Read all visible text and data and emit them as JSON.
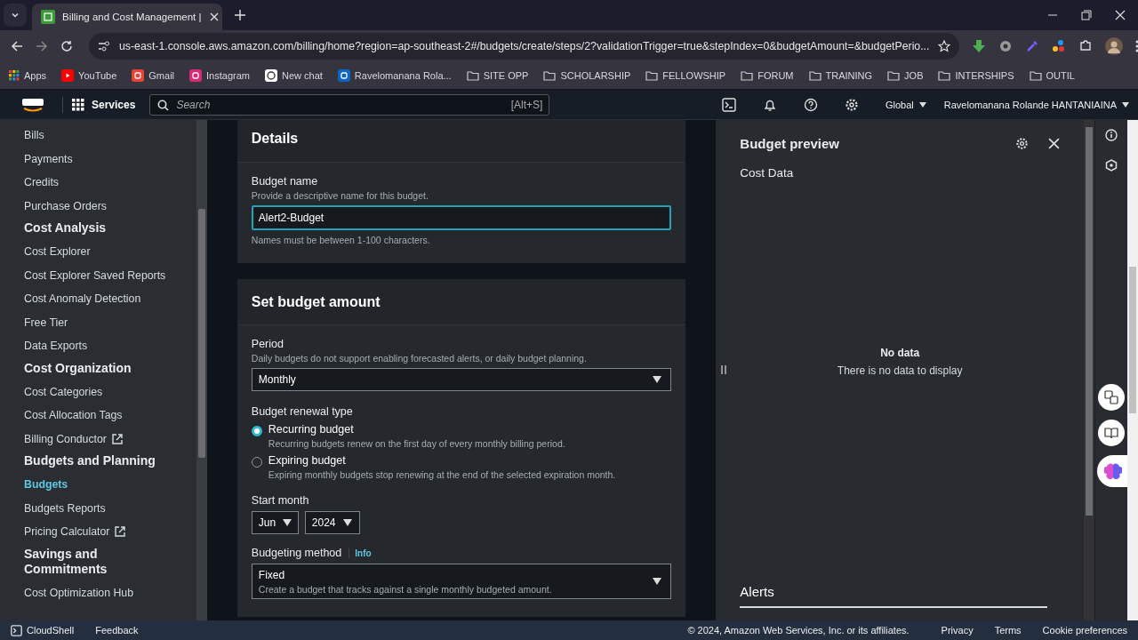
{
  "browser": {
    "tab_title": "Billing and Cost Management |",
    "url": "us-east-1.console.aws.amazon.com/billing/home?region=ap-southeast-2#/budgets/create/steps/2?validationTrigger=true&stepIndex=0&budgetAmount=&budgetPerio...",
    "bookmarks": [
      {
        "label": "Apps",
        "kind": "apps"
      },
      {
        "label": "YouTube",
        "kind": "youtube"
      },
      {
        "label": "Gmail",
        "kind": "gmail"
      },
      {
        "label": "Instagram",
        "kind": "instagram"
      },
      {
        "label": "New chat",
        "kind": "chat"
      },
      {
        "label": "Ravelomanana Rola...",
        "kind": "linkedin"
      },
      {
        "label": "SITE OPP",
        "kind": "folder"
      },
      {
        "label": "SCHOLARSHIP",
        "kind": "folder"
      },
      {
        "label": "FELLOWSHIP",
        "kind": "folder"
      },
      {
        "label": "FORUM",
        "kind": "folder"
      },
      {
        "label": "TRAINING",
        "kind": "folder"
      },
      {
        "label": "JOB",
        "kind": "folder"
      },
      {
        "label": "INTERSHIPS",
        "kind": "folder"
      },
      {
        "label": "OUTIL",
        "kind": "folder"
      }
    ]
  },
  "console_header": {
    "services": "Services",
    "search_placeholder": "Search",
    "shortcut": "[Alt+S]",
    "region": "Global",
    "user": "Ravelomanana Rolande HANTANIAINA"
  },
  "sidebar": {
    "items": [
      {
        "label": "Bills",
        "kind": "link",
        "selected": false,
        "external": false
      },
      {
        "label": "Payments",
        "kind": "link",
        "selected": false,
        "external": false
      },
      {
        "label": "Credits",
        "kind": "link",
        "selected": false,
        "external": false
      },
      {
        "label": "Purchase Orders",
        "kind": "link",
        "selected": false,
        "external": false
      },
      {
        "label": "Cost Analysis",
        "kind": "heading"
      },
      {
        "label": "Cost Explorer",
        "kind": "link",
        "selected": false,
        "external": false
      },
      {
        "label": "Cost Explorer Saved Reports",
        "kind": "link",
        "selected": false,
        "external": false
      },
      {
        "label": "Cost Anomaly Detection",
        "kind": "link",
        "selected": false,
        "external": false
      },
      {
        "label": "Free Tier",
        "kind": "link",
        "selected": false,
        "external": false
      },
      {
        "label": "Data Exports",
        "kind": "link",
        "selected": false,
        "external": false
      },
      {
        "label": "Cost Organization",
        "kind": "heading"
      },
      {
        "label": "Cost Categories",
        "kind": "link",
        "selected": false,
        "external": false
      },
      {
        "label": "Cost Allocation Tags",
        "kind": "link",
        "selected": false,
        "external": false
      },
      {
        "label": "Billing Conductor",
        "kind": "link",
        "selected": false,
        "external": true
      },
      {
        "label": "Budgets and Planning",
        "kind": "heading"
      },
      {
        "label": "Budgets",
        "kind": "link",
        "selected": true,
        "external": false
      },
      {
        "label": "Budgets Reports",
        "kind": "link",
        "selected": false,
        "external": false
      },
      {
        "label": "Pricing Calculator",
        "kind": "link",
        "selected": false,
        "external": true
      },
      {
        "label": "Savings and Commitments",
        "kind": "heading"
      },
      {
        "label": "Cost Optimization Hub",
        "kind": "link",
        "selected": false,
        "external": false
      }
    ]
  },
  "details": {
    "title": "Details",
    "budget_name": {
      "label": "Budget name",
      "description": "Provide a descriptive name for this budget.",
      "value": "Alert2-Budget",
      "hint": "Names must be between 1-100 characters."
    }
  },
  "budget_amount": {
    "title": "Set budget amount",
    "period": {
      "label": "Period",
      "description": "Daily budgets do not support enabling forecasted alerts, or daily budget planning.",
      "value": "Monthly"
    },
    "renewal": {
      "label": "Budget renewal type",
      "options": [
        {
          "label": "Recurring budget",
          "description": "Recurring budgets renew on the first day of every monthly billing period.",
          "selected": true
        },
        {
          "label": "Expiring budget",
          "description": "Expiring monthly budgets stop renewing at the end of the selected expiration month.",
          "selected": false
        }
      ]
    },
    "start_month": {
      "label": "Start month",
      "month": "Jun",
      "year": "2024"
    },
    "method": {
      "label": "Budgeting method",
      "info": "Info",
      "value": "Fixed",
      "description": "Create a budget that tracks against a single monthly budgeted amount."
    }
  },
  "preview": {
    "title": "Budget preview",
    "cost_data": "Cost Data",
    "empty_title": "No data",
    "empty_text": "There is no data to display",
    "alerts": "Alerts"
  },
  "footer": {
    "cloudshell": "CloudShell",
    "feedback": "Feedback",
    "copyright": "© 2024, Amazon Web Services, Inc. or its affiliates.",
    "links": [
      "Privacy",
      "Terms",
      "Cookie preferences"
    ]
  }
}
